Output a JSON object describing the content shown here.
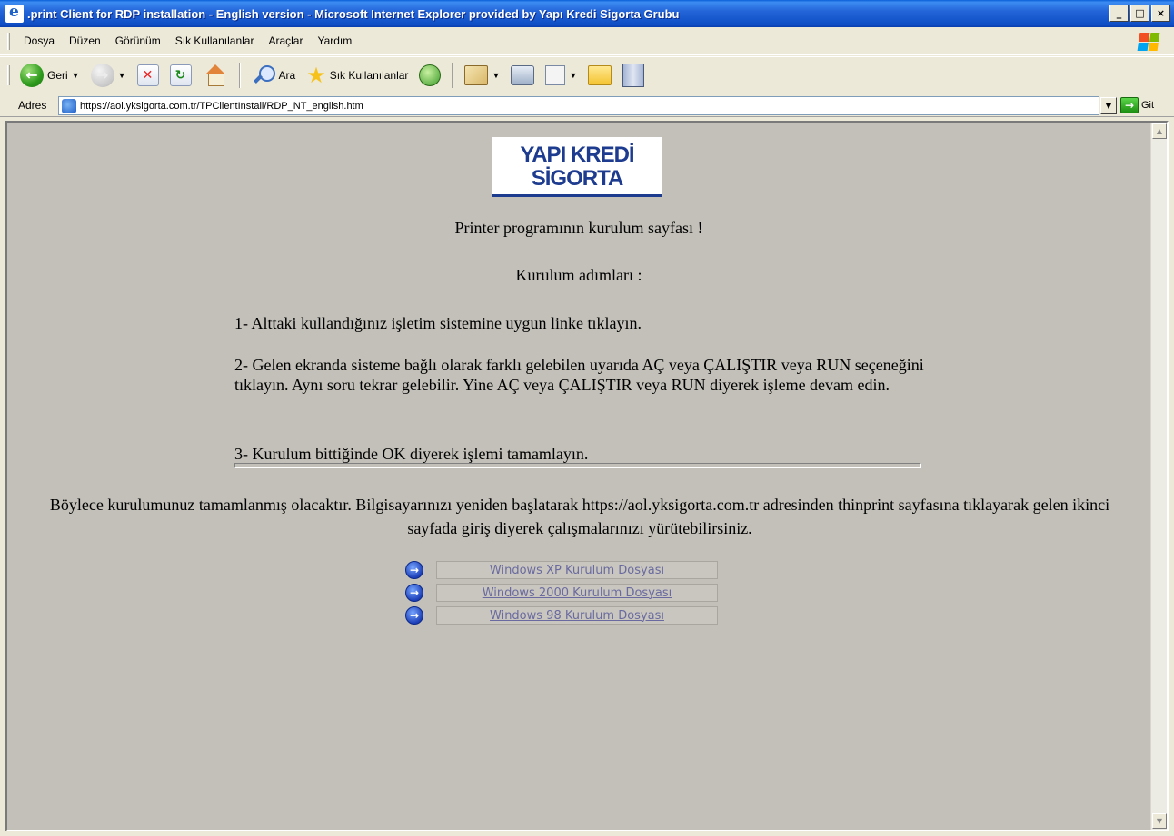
{
  "window": {
    "title": ".print Client for RDP installation - English version - Microsoft Internet Explorer provided by Yapı Kredi Sigorta Grubu",
    "minimize": "_",
    "maximize": "□",
    "close": "×"
  },
  "menu": [
    {
      "label": "Dosya"
    },
    {
      "label": "Düzen"
    },
    {
      "label": "Görünüm"
    },
    {
      "label": "Sık Kullanılanlar"
    },
    {
      "label": "Araçlar"
    },
    {
      "label": "Yardım"
    }
  ],
  "toolbar": {
    "back_label": "Geri",
    "search_label": "Ara",
    "favorites_label": "Sık Kullanılanlar"
  },
  "address": {
    "label": "Adres",
    "url": "https://aol.yksigorta.com.tr/TPClientInstall/RDP_NT_english.htm",
    "go_label": "Git"
  },
  "page": {
    "logo_line1": "YAPI KREDİ",
    "logo_line2": "SİGORTA",
    "heading": "Printer programının kurulum sayfası !",
    "steps_title": "Kurulum adımları :",
    "step1": "1- Alttaki kullandığınız işletim sistemine uygun linke tıklayın.",
    "step2": "2- Gelen ekranda sisteme bağlı olarak farklı gelebilen uyarıda AÇ veya ÇALIŞTIR veya RUN seçeneğini tıklayın. Aynı soru tekrar gelebilir. Yine AÇ veya ÇALIŞTIR veya RUN diyerek işleme devam edin.",
    "step3": "3- Kurulum bittiğinde OK diyerek işlemi tamamlayın.",
    "final": "Böylece kurulumunuz tamamlanmış olacaktır. Bilgisayarınızı yeniden başlatarak https://aol.yksigorta.com.tr adresinden thinprint sayfasına tıklayarak gelen ikinci sayfada giriş diyerek çalışmalarınızı yürütebilirsiniz.",
    "downloads": [
      {
        "label": "Windows XP Kurulum Dosyası"
      },
      {
        "label": "Windows 2000 Kurulum Dosyası"
      },
      {
        "label": "Windows 98 Kurulum Dosyası"
      }
    ]
  },
  "colors": {
    "titlebar": "#0f4fc6",
    "chrome": "#ece9d8",
    "page_background": "#c2c0b8",
    "logo_blue": "#1d3b8f",
    "logo_red": "#c8281e"
  }
}
